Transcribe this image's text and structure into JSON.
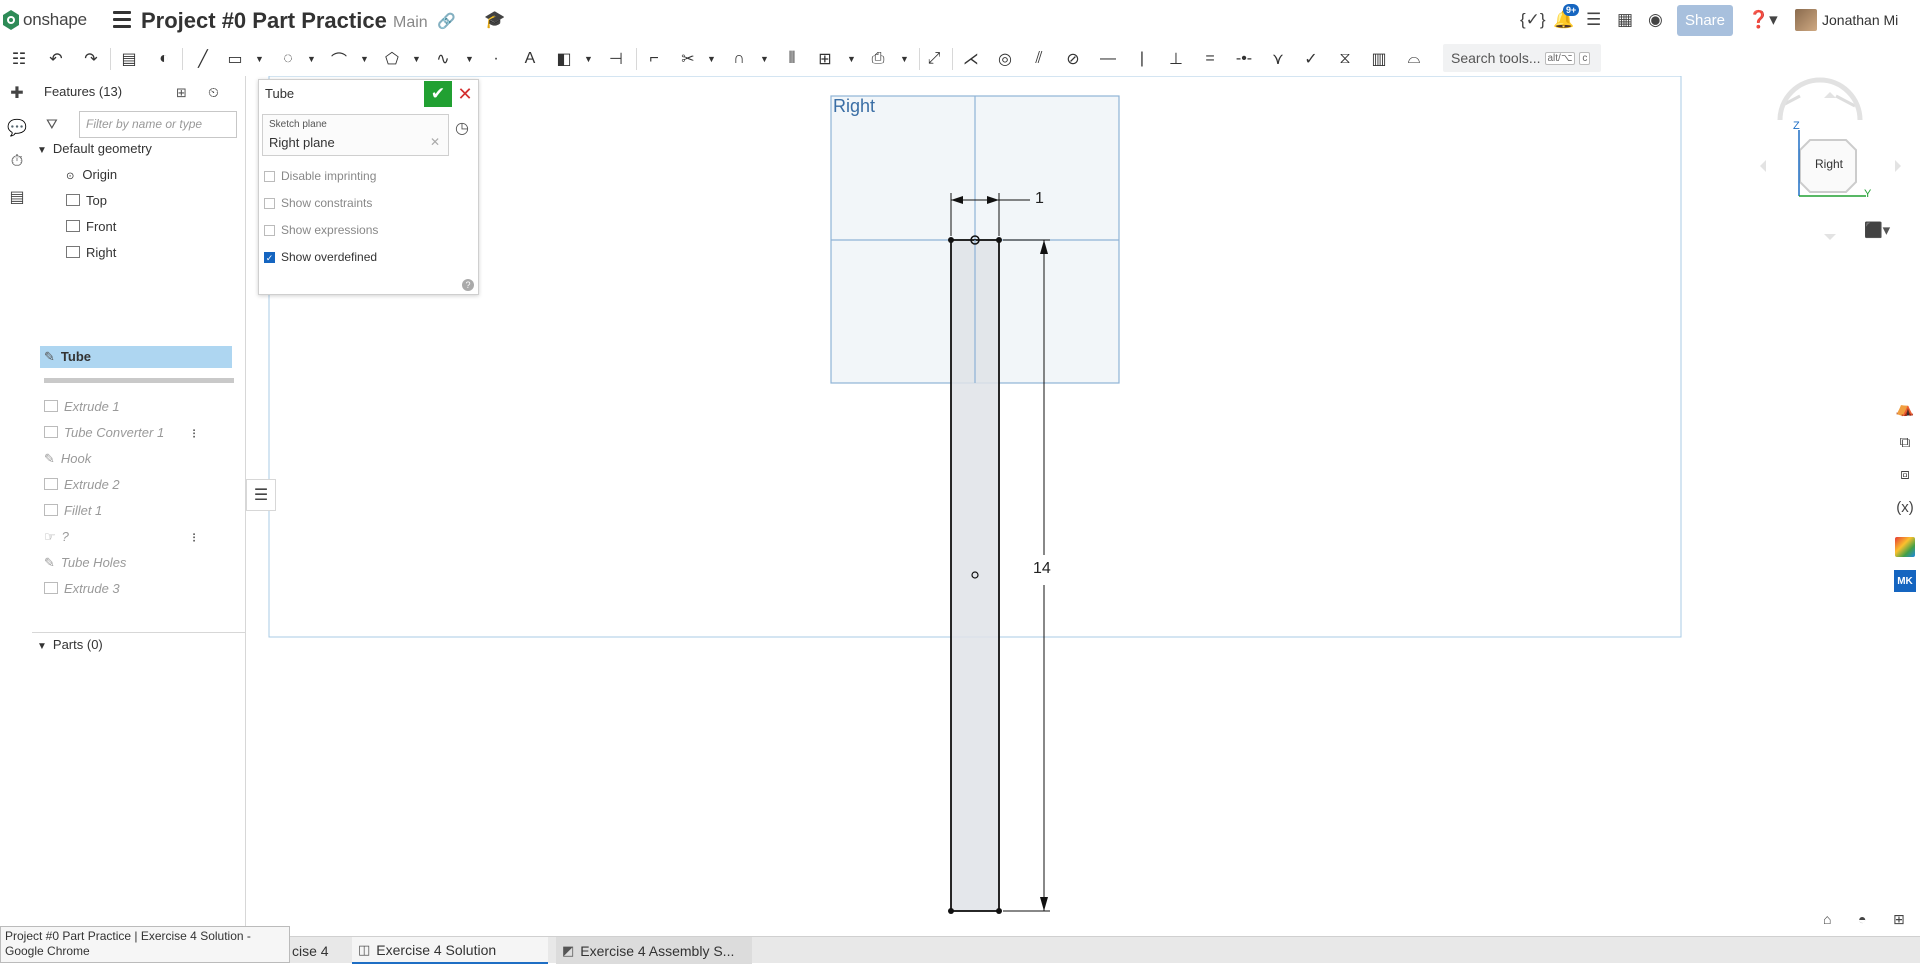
{
  "header": {
    "brand": "onshape",
    "doc_title": "Project #0 Part Practice",
    "branch": "Main",
    "share_label": "Share",
    "notification_count": "9+",
    "user_name": "Jonathan Mi"
  },
  "toolbar": {
    "search_label": "Search tools...",
    "search_shortcut_mod": "alt/⌥",
    "search_shortcut_key": "c"
  },
  "feature_tree": {
    "title": "Features (13)",
    "filter_placeholder": "Filter by name or type",
    "default_geometry": "Default geometry",
    "origin": "Origin",
    "planes": [
      "Top",
      "Front",
      "Right"
    ],
    "selected": "Tube",
    "rolled_features": [
      "Extrude 1",
      "Tube Converter 1",
      "Hook",
      "Extrude 2",
      "Fillet 1",
      "?",
      "Tube Holes",
      "Extrude 3"
    ],
    "parts_title": "Parts (0)"
  },
  "sketch_dialog": {
    "name": "Tube",
    "sketch_plane_label": "Sketch plane",
    "sketch_plane_value": "Right plane",
    "options": [
      {
        "label": "Disable imprinting",
        "checked": false
      },
      {
        "label": "Show constraints",
        "checked": false
      },
      {
        "label": "Show expressions",
        "checked": false
      },
      {
        "label": "Show overdefined",
        "checked": true
      }
    ]
  },
  "canvas": {
    "plane_label": "Right",
    "dim_width": "1",
    "dim_height": "14"
  },
  "view_cube": {
    "face": "Right",
    "axis_z": "Z",
    "axis_y": "Y"
  },
  "tabs": {
    "tab1": "cise 4",
    "tab2": "Exercise 4 Solution",
    "tab3": "Exercise 4 Assembly S..."
  },
  "tooltip": "Project #0 Part Practice | Exercise 4 Solution - Google Chrome",
  "colors": {
    "plane_line": "#8fb3d6",
    "plane_fill": "#f2f6f9",
    "sketch_fill": "#e0e4e8",
    "accent": "#1e6ec4",
    "ok_green": "#21a032"
  }
}
